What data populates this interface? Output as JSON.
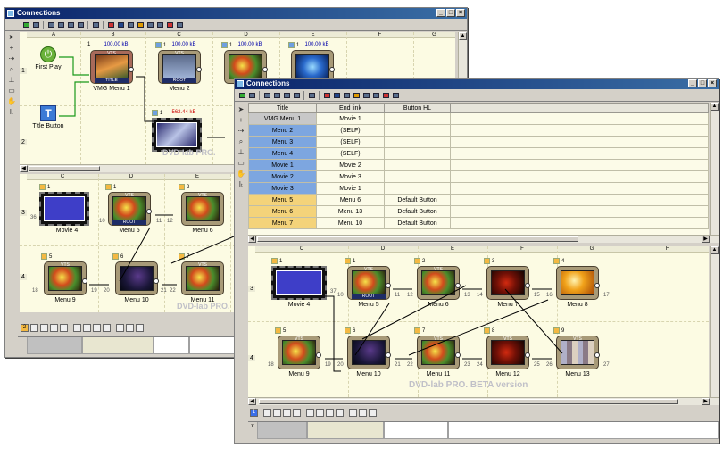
{
  "back_window": {
    "title": "Connections",
    "columns_top": [
      "A",
      "B",
      "C",
      "D",
      "E",
      "F",
      "G"
    ],
    "rows_top": [
      "1",
      "2"
    ],
    "nodes_top": [
      {
        "id": "first-play",
        "label": "First Play"
      },
      {
        "id": "title-button",
        "label": "Title Button"
      },
      {
        "id": "vmg-menu-1",
        "label": "VMG Menu 1",
        "size": "100.00 kB",
        "num": "1",
        "vts": "VTS",
        "badge": "TITLE"
      },
      {
        "id": "menu-2",
        "label": "Menu 2",
        "size": "100.00 kB",
        "num": "1",
        "vts": "VTS",
        "badge": "ROOT"
      },
      {
        "id": "menu-3",
        "label": "",
        "size": "100.00 kB",
        "num": "1",
        "vts": "VTS"
      },
      {
        "id": "menu-4",
        "label": "",
        "size": "100.00 kB",
        "num": "1",
        "vts": "VTS"
      },
      {
        "id": "movie-1",
        "label": "",
        "size": "562.44 kB",
        "num": "1",
        "vts": ""
      }
    ],
    "columns_bottom": [
      "C",
      "D",
      "E"
    ],
    "rows_bottom": [
      "3",
      "4"
    ],
    "nodes_bottom": [
      {
        "label": "Movie 4",
        "num": "1",
        "side": "36"
      },
      {
        "label": "Menu 5",
        "num": "1",
        "side": "10",
        "side2": "11",
        "badge": "ROOT",
        "vts": "VTS"
      },
      {
        "label": "Menu 6",
        "num": "2",
        "side": "12",
        "vts": "VTS"
      },
      {
        "label": "Menu 9",
        "num": "5",
        "side": "18",
        "side2": "19",
        "vts": "VTS"
      },
      {
        "label": "Menu 10",
        "num": "6",
        "side": "20",
        "side2": "21",
        "vts": ""
      },
      {
        "label": "Menu 11",
        "num": "7",
        "side": "22",
        "side2": "23",
        "vts": "VTS"
      }
    ],
    "watermark": "DVD-lab PRO.",
    "bottom_page": "2"
  },
  "front_window": {
    "title": "Connections",
    "table_headers": [
      "Title",
      "End link",
      "Button HL"
    ],
    "table_rows": [
      {
        "title": "VMG Menu 1",
        "end": "Movie 1",
        "hl": "",
        "kind": "gray"
      },
      {
        "title": "Menu 2",
        "end": "(SELF)",
        "hl": "",
        "kind": "blue"
      },
      {
        "title": "Menu 3",
        "end": "(SELF)",
        "hl": "",
        "kind": "blue"
      },
      {
        "title": "Menu 4",
        "end": "(SELF)",
        "hl": "",
        "kind": "blue"
      },
      {
        "title": "Movie 1",
        "end": "Movie 2",
        "hl": "",
        "kind": "blue"
      },
      {
        "title": "Movie 2",
        "end": "Movie 3",
        "hl": "",
        "kind": "blue"
      },
      {
        "title": "Movie 3",
        "end": "Movie 1",
        "hl": "",
        "kind": "blue"
      },
      {
        "title": "Menu 5",
        "end": "Menu 6",
        "hl": "Default Button",
        "kind": "yellow"
      },
      {
        "title": "Menu 6",
        "end": "Menu 13",
        "hl": "Default Button",
        "kind": "yellow"
      },
      {
        "title": "Menu 7",
        "end": "Menu 10",
        "hl": "Default Button",
        "kind": "yellow"
      }
    ],
    "columns": [
      "C",
      "D",
      "E",
      "F",
      "G",
      "H"
    ],
    "rows": [
      "3",
      "4"
    ],
    "nodes": [
      {
        "label": "Movie 4",
        "num": "1",
        "side": "",
        "side2": "37",
        "kind": "film"
      },
      {
        "label": "Menu 5",
        "num": "1",
        "side": "10",
        "side2": "11",
        "vts": "VTS",
        "badge": "ROOT"
      },
      {
        "label": "Menu 6",
        "num": "2",
        "side": "12",
        "side2": "13",
        "vts": "VTS"
      },
      {
        "label": "Menu 7",
        "num": "3",
        "side": "14",
        "side2": "15",
        "vts": ""
      },
      {
        "label": "Menu 8",
        "num": "4",
        "side": "16",
        "side2": "17",
        "vts": ""
      },
      {
        "label": "Menu 9",
        "num": "5",
        "side": "18",
        "side2": "19",
        "vts": "VTS"
      },
      {
        "label": "Menu 10",
        "num": "6",
        "side": "20",
        "side2": "21",
        "vts": ""
      },
      {
        "label": "Menu 11",
        "num": "7",
        "side": "22",
        "side2": "23",
        "vts": "VTS"
      },
      {
        "label": "Menu 12",
        "num": "8",
        "side": "24",
        "side2": "25",
        "vts": "VTS"
      },
      {
        "label": "Menu 13",
        "num": "9",
        "side": "26",
        "side2": "27",
        "vts": "VTS"
      }
    ],
    "watermark": "DVD-lab PRO. BETA version",
    "bottom_page": "1",
    "bottom_x": "x"
  },
  "colors": {
    "titlebar_start": "#0a246a",
    "titlebar_end": "#3a6ea5",
    "grid_bg": "#fcfbe3",
    "row_blue": "#7da6e0",
    "row_yellow": "#f4d37a",
    "row_gray": "#c8c8c8"
  },
  "icons": [
    "arrow-pointer-icon",
    "plus-icon",
    "connect-icon",
    "zoom-icon",
    "hand-icon",
    "text-icon"
  ]
}
